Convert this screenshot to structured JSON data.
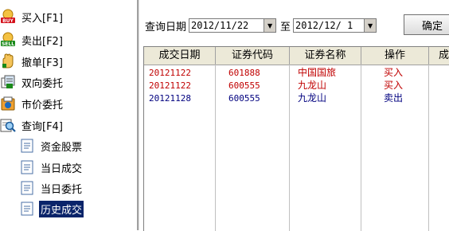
{
  "sidebar": {
    "items": [
      {
        "label": "买入[F1]",
        "icon": "buy-icon"
      },
      {
        "label": "卖出[F2]",
        "icon": "sell-icon"
      },
      {
        "label": "撤单[F3]",
        "icon": "cancel-order-icon"
      },
      {
        "label": "双向委托",
        "icon": "two-way-order-icon"
      },
      {
        "label": "市价委托",
        "icon": "market-order-icon"
      },
      {
        "label": "查询[F4]",
        "icon": "query-icon"
      }
    ],
    "query_children": [
      {
        "label": "资金股票",
        "icon": "document-icon"
      },
      {
        "label": "当日成交",
        "icon": "document-icon"
      },
      {
        "label": "当日委托",
        "icon": "document-icon"
      },
      {
        "label": "历史成交",
        "icon": "document-icon",
        "selected": true
      }
    ]
  },
  "query": {
    "date_label": "查询日期",
    "start_date": "2012/11/22",
    "to_label": "至",
    "end_date": "2012/12/ 1",
    "confirm_label": "确定"
  },
  "table": {
    "columns": [
      "成交日期",
      "证券代码",
      "证券名称",
      "操作",
      "成"
    ],
    "rows": [
      {
        "date": "20121122",
        "code": "601888",
        "name": "中国国旅",
        "op": "买入",
        "side": "buy"
      },
      {
        "date": "20121122",
        "code": "600555",
        "name": "九龙山",
        "op": "买入",
        "side": "buy"
      },
      {
        "date": "20121128",
        "code": "600555",
        "name": "九龙山",
        "op": "卖出",
        "side": "sell"
      }
    ]
  },
  "colors": {
    "buy": "#c00000",
    "sell": "#00007f",
    "selection": "#0a246a",
    "header": "#ece9d8"
  }
}
